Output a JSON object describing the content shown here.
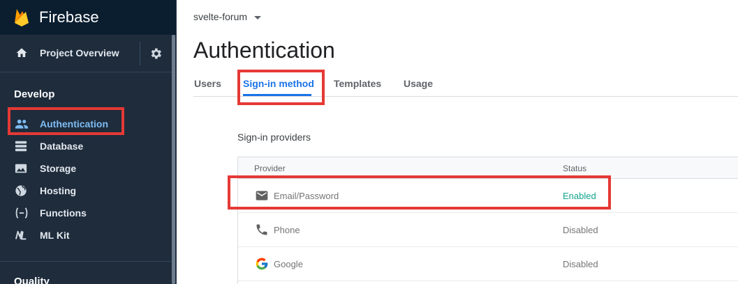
{
  "app": {
    "name": "Firebase"
  },
  "sidebar": {
    "overview_label": "Project Overview",
    "sections": [
      {
        "title": "Develop"
      },
      {
        "title": "Quality"
      }
    ],
    "items": [
      {
        "label": "Authentication",
        "icon": "people-icon",
        "active": true
      },
      {
        "label": "Database",
        "icon": "database-icon"
      },
      {
        "label": "Storage",
        "icon": "storage-icon"
      },
      {
        "label": "Hosting",
        "icon": "globe-icon"
      },
      {
        "label": "Functions",
        "icon": "functions-icon"
      },
      {
        "label": "ML Kit",
        "icon": "mlkit-icon"
      }
    ]
  },
  "header": {
    "project": "svelte-forum",
    "title": "Authentication"
  },
  "tabs": [
    {
      "label": "Users"
    },
    {
      "label": "Sign-in method",
      "active": true
    },
    {
      "label": "Templates"
    },
    {
      "label": "Usage"
    }
  ],
  "providers": {
    "title": "Sign-in providers",
    "col_provider": "Provider",
    "col_status": "Status",
    "rows": [
      {
        "name": "Email/Password",
        "status": "Enabled",
        "icon": "mail-icon"
      },
      {
        "name": "Phone",
        "status": "Disabled",
        "icon": "phone-icon"
      },
      {
        "name": "Google",
        "status": "Disabled",
        "icon": "google-icon"
      }
    ]
  },
  "colors": {
    "sidebar_bg": "#1e2c3c",
    "accent": "#1a73e8",
    "active_nav": "#7fbcf4",
    "enabled": "#12a58e",
    "highlight": "#e53935"
  }
}
